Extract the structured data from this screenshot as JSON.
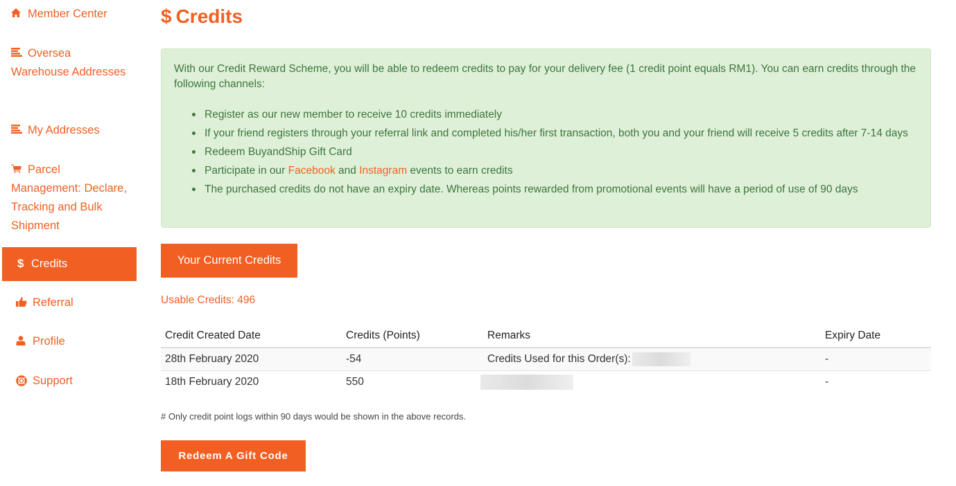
{
  "theme": {
    "accent": "#f15f22",
    "info_bg": "#dff0d8",
    "info_text": "#3c763d"
  },
  "sidebar": {
    "items": [
      {
        "label": "Member Center",
        "icon": "home-icon"
      },
      {
        "label": "Oversea Warehouse Addresses",
        "icon": "list-icon"
      },
      {
        "label": "My Addresses",
        "icon": "list-icon"
      },
      {
        "label": "Parcel Management: Declare, Tracking and Bulk Shipment",
        "icon": "cart-icon"
      },
      {
        "label": "Credits",
        "icon": "dollar-icon",
        "active": true
      },
      {
        "label": "Referral",
        "icon": "thumbs-up-icon"
      },
      {
        "label": "Profile",
        "icon": "user-icon"
      },
      {
        "label": "Support",
        "icon": "life-ring-icon"
      }
    ]
  },
  "header": {
    "icon": "dollar-icon",
    "icon_glyph": "$",
    "title": "Credits"
  },
  "info": {
    "intro": "With our Credit Reward Scheme, you will be able to redeem credits to pay for your delivery fee (1 credit point equals RM1). You can earn credits through the following channels:",
    "bullets": [
      "Register as our new member to receive 10 credits immediately",
      "If your friend registers through your referral link and completed his/her first transaction, both you and your friend will receive 5 credits after 7-14 days",
      "Redeem BuyandShip Gift Card",
      "The purchased credits do not have an expiry date. Whereas points rewarded from promotional events will have a period of use of 90 days"
    ],
    "social_bullet": {
      "prefix": "Participate in our ",
      "link1": "Facebook",
      "middle": " and ",
      "link2": "Instagram",
      "suffix": " events to earn credits"
    }
  },
  "current_credits_button": "Your Current Credits",
  "usable_credits": "Usable Credits: 496",
  "table": {
    "headers": [
      "Credit Created Date",
      "Credits (Points)",
      "Remarks",
      "Expiry Date"
    ],
    "rows": [
      {
        "date": "28th February 2020",
        "points": "-54",
        "remarks": "Credits Used for this Order(s):",
        "expiry": "-"
      },
      {
        "date": "18th February 2020",
        "points": "550",
        "remarks": "",
        "expiry": "-"
      }
    ]
  },
  "note": "# Only credit point logs within 90 days would be shown in the above records.",
  "redeem_button": "Redeem A Gift Code"
}
